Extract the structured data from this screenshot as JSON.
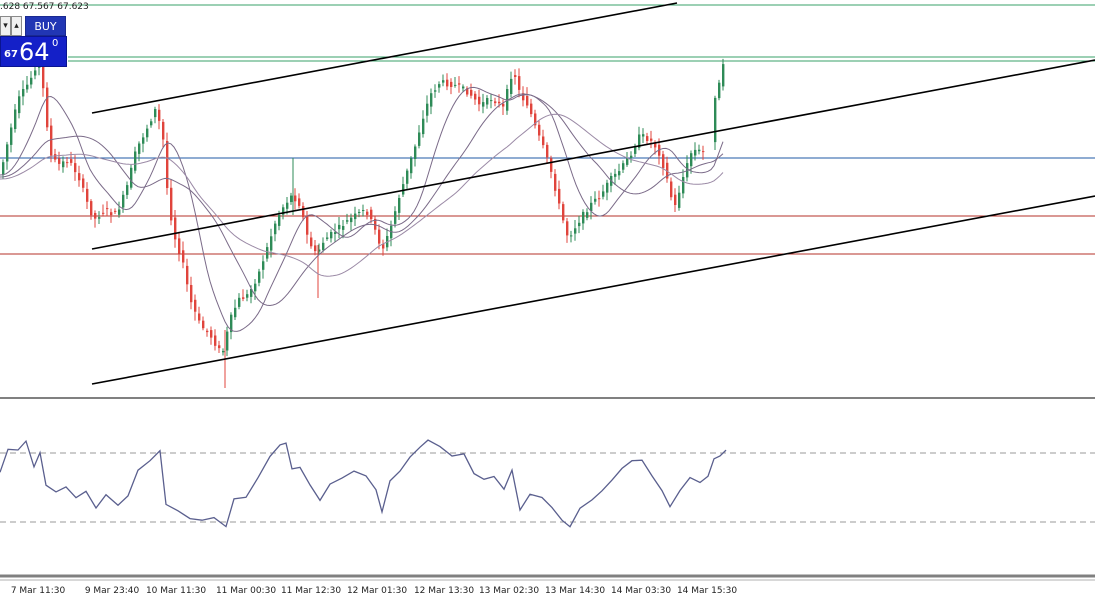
{
  "ohlc_text": ".628 67.567 67.623",
  "trade_panel": {
    "buy_label": "BUY",
    "price_small": "67",
    "price_big": "64",
    "price_sup": "0",
    "buttons": [
      "▾",
      "▴"
    ]
  },
  "colors": {
    "bull_candle": "#2e8b57",
    "bear_candle": "#e0443c",
    "channel_line": "#000000",
    "horizontal_blue": "#1f5aa6",
    "horizontal_red": "#b4322a",
    "horizontal_green": "#3aa06a",
    "ma_line": "#7a6a88",
    "oscillator": "#5a5f8e",
    "panel_separator": "#808080"
  },
  "x_axis_labels": [
    "7 Mar 11:30",
    "9 Mar 23:40",
    "10 Mar 11:30",
    "11 Mar 00:30",
    "11 Mar 12:30",
    "12 Mar 01:30",
    "12 Mar 13:30",
    "13 Mar 02:30",
    "13 Mar 14:30",
    "14 Mar 03:30",
    "14 Mar 15:30"
  ]
}
